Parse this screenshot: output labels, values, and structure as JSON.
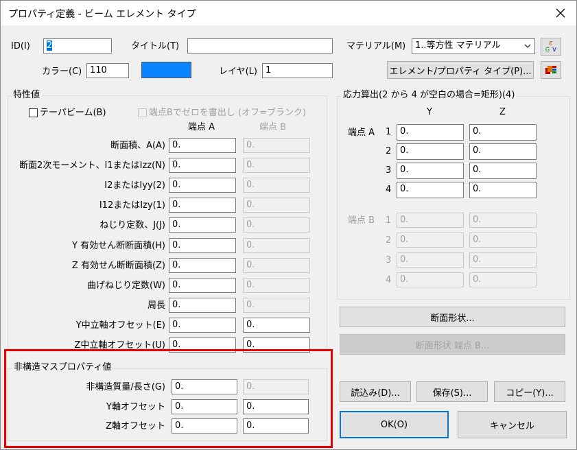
{
  "window": {
    "title": "プロパティ定義 - ビーム エレメント タイプ"
  },
  "top": {
    "id_label": "ID(I)",
    "id_value": "2",
    "title_label": "タイトル(T)",
    "title_value": "",
    "material_label": "マテリアル(M)",
    "material_value": "1..等方性 マテリアル",
    "color_label": "カラー(C)",
    "color_value": "110",
    "color_swatch": "#0a84ff",
    "layer_label": "レイヤ(L)",
    "layer_value": "1",
    "elem_prop_button": "エレメント/プロパティ タイプ(P)...",
    "material_icon_text": "EGV"
  },
  "props": {
    "group_title": "特性値",
    "taper_label": "テーパビーム(B)",
    "write_zero_label": "端点Bでゼロを書出し (オフ=ブランク)",
    "col_a": "端点 A",
    "col_b": "端点 B",
    "rows": [
      {
        "label": "断面積、A(A)",
        "a": "0.",
        "b": "0."
      },
      {
        "label": "断面2次モーメント、I1またはIzz(N)",
        "a": "0.",
        "b": "0."
      },
      {
        "label": "I2またはIyy(2)",
        "a": "0.",
        "b": "0."
      },
      {
        "label": "I12またはIzy(1)",
        "a": "0.",
        "b": "0."
      },
      {
        "label": "ねじり定数、J(J)",
        "a": "0.",
        "b": "0."
      },
      {
        "label": "Y 有効せん断断面積(H)",
        "a": "0.",
        "b": "0."
      },
      {
        "label": "Z 有効せん断断面積(Z)",
        "a": "0.",
        "b": "0."
      },
      {
        "label": "曲げねじり定数(W)",
        "a": "0.",
        "b": "0."
      },
      {
        "label": "周長",
        "a": "0.",
        "b": "0."
      },
      {
        "label": "Y中立軸オフセット(E)",
        "a": "0.",
        "b": "0."
      },
      {
        "label": "Z中立軸オフセット(U)",
        "a": "0.",
        "b": "0."
      }
    ]
  },
  "nonstruct": {
    "group_title": "非構造マスプロパティ値",
    "rows": [
      {
        "label": "非構造質量/長さ(G)",
        "a": "0.",
        "b": "0."
      },
      {
        "label": "Y軸オフセット",
        "a": "0.",
        "b": "0."
      },
      {
        "label": "Z軸オフセット",
        "a": "0.",
        "b": "0."
      }
    ]
  },
  "stress": {
    "group_title": "応力算出(2 から 4 が空白の場合=矩形)(4)",
    "col_y": "Y",
    "col_z": "Z",
    "end_a_label": "端点 A",
    "end_b_label": "端点 B",
    "rows_a": [
      {
        "num": "1",
        "y": "0.",
        "z": "0."
      },
      {
        "num": "2",
        "y": "0.",
        "z": "0."
      },
      {
        "num": "3",
        "y": "0.",
        "z": "0."
      },
      {
        "num": "4",
        "y": "0.",
        "z": "0."
      }
    ],
    "rows_b": [
      {
        "num": "1",
        "y": "0.",
        "z": "0."
      },
      {
        "num": "2",
        "y": "0.",
        "z": "0."
      },
      {
        "num": "3",
        "y": "0.",
        "z": "0."
      },
      {
        "num": "4",
        "y": "0.",
        "z": "0."
      }
    ]
  },
  "buttons": {
    "shape": "断面形状...",
    "shape_b": "断面形状  端点 B...",
    "load": "読込み(D)...",
    "save": "保存(S)...",
    "copy": "コピー(Y)...",
    "ok": "OK(O)",
    "cancel": "キャンセル"
  },
  "colors": {
    "highlight": "#e60000",
    "accent": "#0078d7"
  }
}
